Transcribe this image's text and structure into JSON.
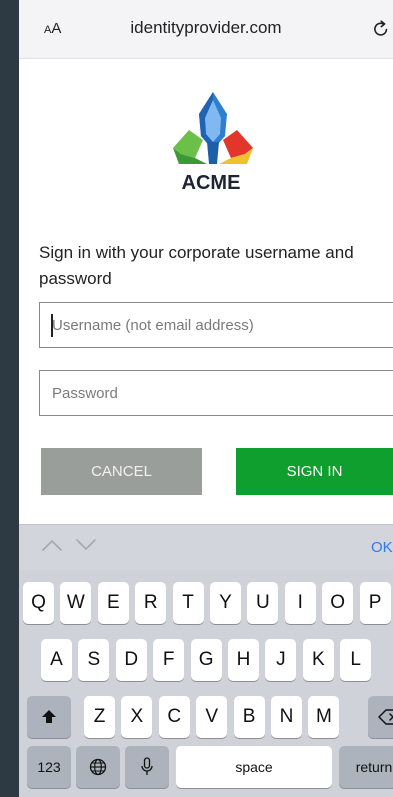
{
  "browser": {
    "aa_label_small": "A",
    "aa_label_big": "A",
    "url": "identityprovider.com"
  },
  "logo": {
    "text": "ACME",
    "colors": [
      "#2f7fd1",
      "#6cc04a",
      "#f2c12e",
      "#e2352b"
    ]
  },
  "form": {
    "heading": "Sign in with your corporate username and password",
    "username_placeholder": "Username (not email address)",
    "password_placeholder": "Password",
    "cancel_label": "CANCEL",
    "signin_label": "SIGN IN"
  },
  "keyboard": {
    "done_label": "OK",
    "row1": [
      "Q",
      "W",
      "E",
      "R",
      "T",
      "Y",
      "U",
      "I",
      "O",
      "P"
    ],
    "row2": [
      "A",
      "S",
      "D",
      "F",
      "G",
      "H",
      "J",
      "K",
      "L"
    ],
    "row3": [
      "Z",
      "X",
      "C",
      "V",
      "B",
      "N",
      "M"
    ],
    "numbers_label": "123",
    "space_label": "space",
    "return_label": "return",
    "icons": [
      "shift-icon",
      "backspace-icon",
      "globe-icon",
      "microphone-icon",
      "chevron-up-icon",
      "chevron-down-icon",
      "reload-icon"
    ]
  },
  "colors": {
    "signin_green": "#0f9f2e",
    "cancel_gray": "#999e9b",
    "link_blue": "#2a7bf6"
  }
}
